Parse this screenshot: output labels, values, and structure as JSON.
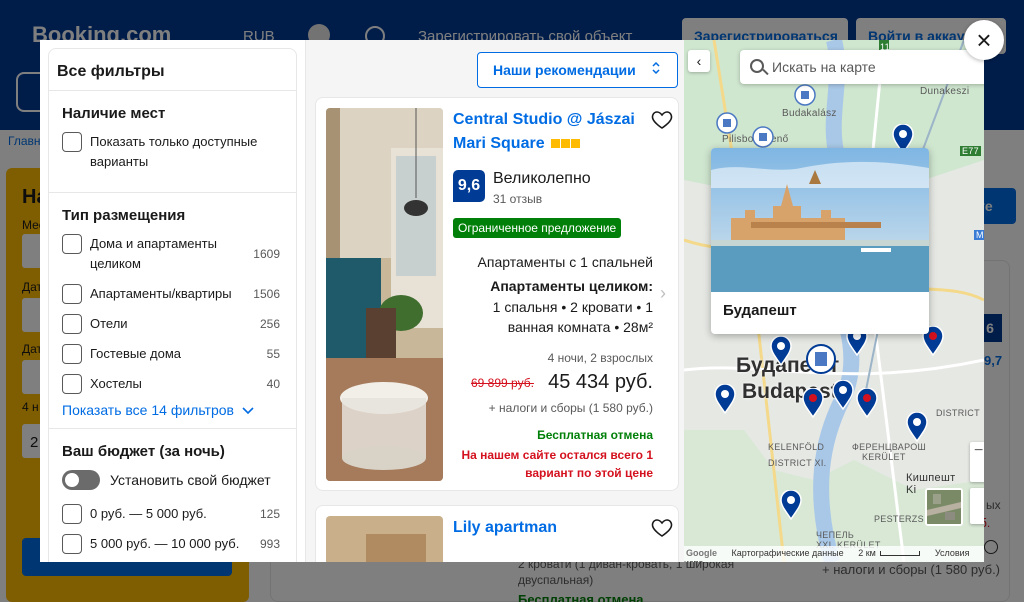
{
  "background": {
    "logo": "Booking.com",
    "currency": "RUB",
    "list_property": "Зарегистрировать свой объект",
    "register_button": "Зарегистрироваться",
    "signin_button": "Войти в аккау",
    "breadcrumb": "Главн",
    "search_title": "На",
    "field_labels": [
      "Мес",
      "Дат",
      "Дат",
      "4 н"
    ],
    "stepper_value": "2",
    "show_on_map_button": "те",
    "card_rating": "6",
    "card_rating_text": "9,7",
    "card_price_text": "ых",
    "card_strike": "б.",
    "card_beds": "2 кровати (1 диван-кровать, 1 широкая двуспальная)",
    "card_taxes": "+ налоги и сборы (1 580 руб.)",
    "card_free": "Бесплатная отмена"
  },
  "close_icon": "×",
  "filters": {
    "title": "Все фильтры",
    "availability": {
      "title": "Наличие мест",
      "options": [
        {
          "label": "Показать только доступные варианты"
        }
      ]
    },
    "property_type": {
      "title": "Тип размещения",
      "options": [
        {
          "label": "Дома и апартаменты целиком",
          "count": "1609"
        },
        {
          "label": "Апартаменты/квартиры",
          "count": "1506"
        },
        {
          "label": "Отели",
          "count": "256"
        },
        {
          "label": "Гостевые дома",
          "count": "55"
        },
        {
          "label": "Хостелы",
          "count": "40"
        }
      ],
      "show_more": "Показать все 14 фильтров"
    },
    "budget": {
      "title": "Ваш бюджет (за ночь)",
      "toggle_label": "Установить свой бюджет",
      "options": [
        {
          "label": "0 руб. — 5 000 руб.",
          "count": "125"
        },
        {
          "label": "5 000 руб. — 10 000 руб.",
          "count": "993"
        }
      ]
    }
  },
  "sort": {
    "label": "Наши рекомендации"
  },
  "cards": [
    {
      "name": "Central Studio @ Jászai Mari Square",
      "stars": 3,
      "score": "9,6",
      "score_word": "Великолепно",
      "reviews": "31 отзыв",
      "deal": "Ограниченное предложение",
      "unit_type": "Апартаменты с 1 спальней",
      "unit_title": "Апартаменты целиком:",
      "unit_beds": "1 спальня • 2 кровати • 1 ванная комната • 28м²",
      "nights": "4 ночи, 2 взрослых",
      "old_price": "69 899 руб.",
      "price": "45 434 руб.",
      "taxes": "+ налоги и сборы (1 580 руб.)",
      "free_cancel": "Бесплатная отмена",
      "scarcity": "На нашем сайте остался всего 1 вариант по этой цене"
    },
    {
      "name": "Lily apartman"
    }
  ],
  "map": {
    "search_placeholder": "Искать на карте",
    "popup_label": "Будапешт",
    "city_ru": "Будапешт",
    "city_hu": "Budapest",
    "labels": {
      "dunakeszi": "Dunakeszi",
      "budakalasz": "Budakalász",
      "pilisborosjeno": "Pilisborosjenő",
      "district": "DISTRICT",
      "kelenfold": "KELENFÖLD",
      "ferencvaros": "ФЕРЕНЦВАРОШ",
      "district11": "DISTRICT XI.",
      "kerulet": "KERÜLET",
      "kispest": "Кишпешт",
      "ki": "Ki",
      "csepel": "ЧЕПЕЛЬ",
      "xxi": "XXI. KERÜLET",
      "pesterzs": "PESTERZS",
      "e77": "E77",
      "n11": "11",
      "m": "M"
    },
    "attribution": {
      "google": "Google",
      "map_data": "Картографические данные",
      "scale": "2 км",
      "terms": "Условия испо"
    }
  },
  "colors": {
    "brand": "#003b95",
    "link": "#006ce4",
    "deal": "#008009",
    "price_red": "#d4111e",
    "yellow": "#febb02"
  }
}
